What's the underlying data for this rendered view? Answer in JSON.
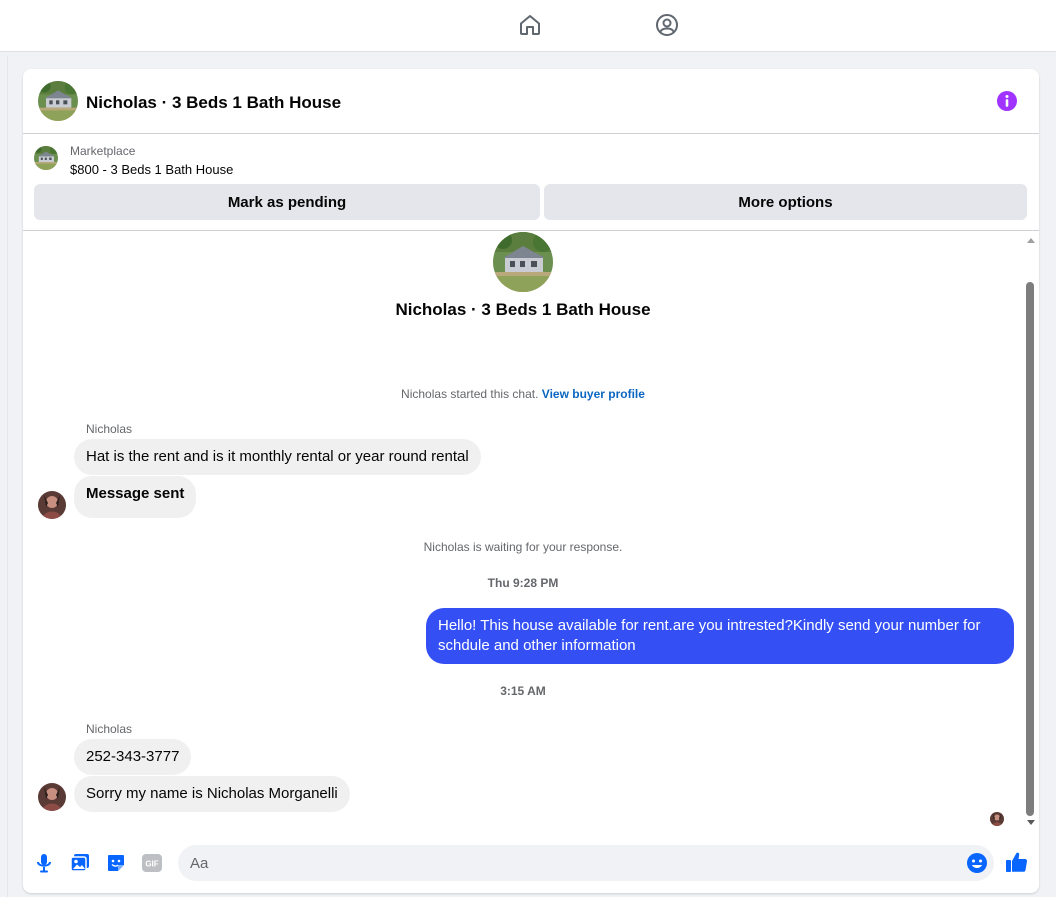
{
  "nav": {
    "home_icon": "home-icon",
    "profile_icon": "profile-icon"
  },
  "conversation": {
    "title": "Nicholas · 3 Beds 1 Bath House",
    "info_icon": "info-icon"
  },
  "marketplace": {
    "label": "Marketplace",
    "listing": "$800 - 3 Beds 1 Bath House",
    "mark_pending": "Mark as pending",
    "more_options": "More options"
  },
  "thread": {
    "title": "Nicholas · 3 Beds 1 Bath House",
    "started_prefix": "Nicholas started this chat.",
    "view_profile": "View buyer profile",
    "waiting": "Nicholas is waiting for your response.",
    "groups": [
      {
        "sender": "Nicholas",
        "messages": [
          "Hat is the rent and is it monthly rental or year round rental",
          "Message sent"
        ]
      },
      {
        "sender": "Nicholas",
        "messages": [
          "252-343-3777",
          "Sorry my name is Nicholas Morganelli"
        ]
      }
    ],
    "time1": "Thu 9:28 PM",
    "outgoing": "Hello! This house available for rent.are you intrested?Kindly send your number for schdule and other information",
    "time2": "3:15 AM"
  },
  "composer": {
    "placeholder": "Aa",
    "icons": [
      "microphone-icon",
      "photo-icon",
      "sticker-icon",
      "gif-icon",
      "emoji-icon",
      "like-icon"
    ],
    "gif_label": "GIF"
  },
  "colors": {
    "accent": "#0866ff",
    "outgoing_bubble": "#3450f5",
    "info": "#a033ff"
  }
}
